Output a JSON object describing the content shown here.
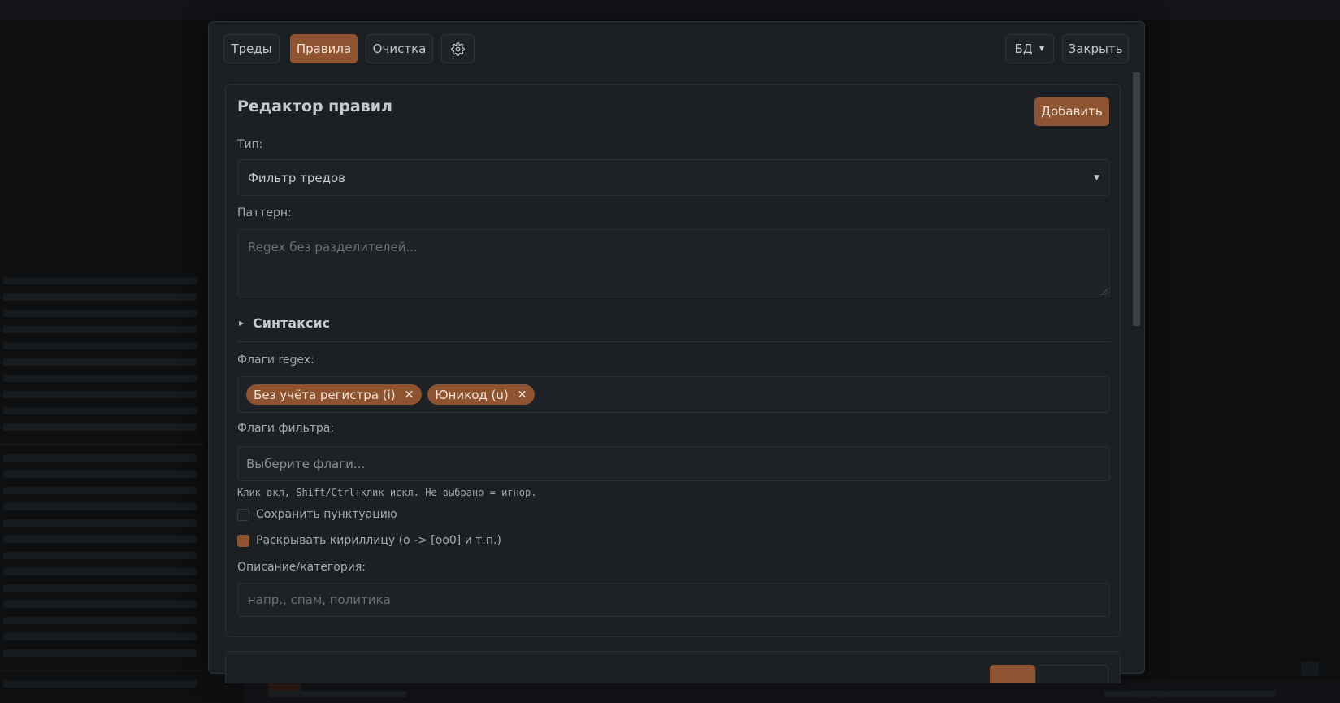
{
  "modal": {
    "tabs": [
      {
        "label": "Треды",
        "active": false
      },
      {
        "label": "Правила",
        "active": true
      },
      {
        "label": "Очистка",
        "active": false
      }
    ],
    "settings_icon": "gear-icon",
    "db_label": "БД",
    "close_label": "Закрыть"
  },
  "editor": {
    "title": "Редактор правил",
    "add_label": "Добавить",
    "type_label": "Тип:",
    "type_value": "Фильтр тредов",
    "pattern_label": "Паттерн:",
    "pattern_placeholder": "Regex без разделителей...",
    "syntax_label": "Синтаксис",
    "regex_flags_label": "Флаги regex:",
    "regex_flags": [
      "Без учёта регистра (i)",
      "Юникод (u)"
    ],
    "filter_flags_label": "Флаги фильтра:",
    "filter_flags_placeholder": "Выберите флаги...",
    "hint": "Клик вкл, Shift/Ctrl+клик искл. Не выбрано = игнор.",
    "keep_punct_label": "Сохранить пунктуацию",
    "keep_punct_checked": false,
    "expand_cyr_label": "Раскрывать кириллицу (о -> [оо0] и т.п.)",
    "expand_cyr_checked": true,
    "description_label": "Описание/категория:",
    "description_placeholder": "напр., спам, политика"
  },
  "colors": {
    "accent": "#8e5330",
    "panel": "#1c1f23",
    "backdrop": "#0d0f11"
  }
}
